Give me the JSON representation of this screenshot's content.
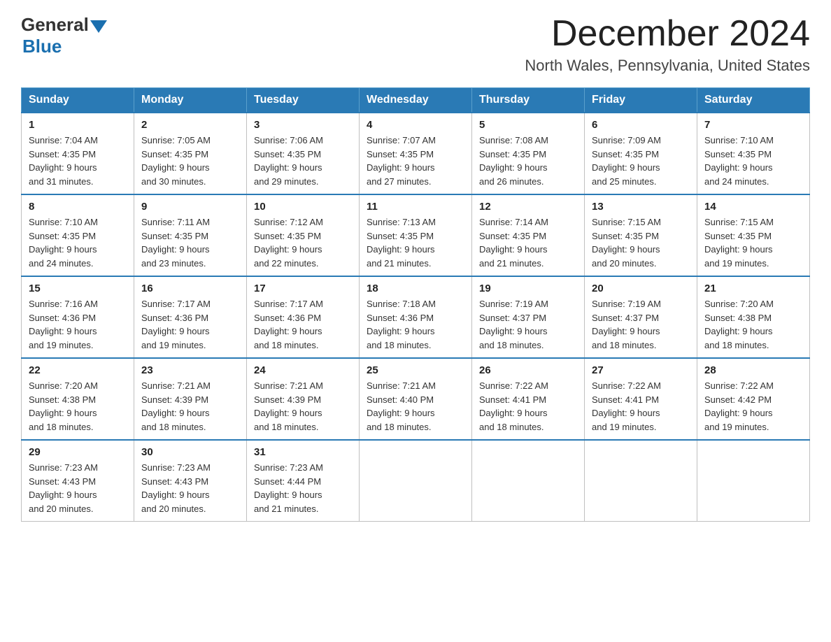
{
  "logo": {
    "general": "General",
    "blue": "Blue"
  },
  "title": {
    "month_year": "December 2024",
    "location": "North Wales, Pennsylvania, United States"
  },
  "weekdays": [
    "Sunday",
    "Monday",
    "Tuesday",
    "Wednesday",
    "Thursday",
    "Friday",
    "Saturday"
  ],
  "weeks": [
    [
      {
        "day": "1",
        "sunrise": "7:04 AM",
        "sunset": "4:35 PM",
        "daylight": "9 hours and 31 minutes."
      },
      {
        "day": "2",
        "sunrise": "7:05 AM",
        "sunset": "4:35 PM",
        "daylight": "9 hours and 30 minutes."
      },
      {
        "day": "3",
        "sunrise": "7:06 AM",
        "sunset": "4:35 PM",
        "daylight": "9 hours and 29 minutes."
      },
      {
        "day": "4",
        "sunrise": "7:07 AM",
        "sunset": "4:35 PM",
        "daylight": "9 hours and 27 minutes."
      },
      {
        "day": "5",
        "sunrise": "7:08 AM",
        "sunset": "4:35 PM",
        "daylight": "9 hours and 26 minutes."
      },
      {
        "day": "6",
        "sunrise": "7:09 AM",
        "sunset": "4:35 PM",
        "daylight": "9 hours and 25 minutes."
      },
      {
        "day": "7",
        "sunrise": "7:10 AM",
        "sunset": "4:35 PM",
        "daylight": "9 hours and 24 minutes."
      }
    ],
    [
      {
        "day": "8",
        "sunrise": "7:10 AM",
        "sunset": "4:35 PM",
        "daylight": "9 hours and 24 minutes."
      },
      {
        "day": "9",
        "sunrise": "7:11 AM",
        "sunset": "4:35 PM",
        "daylight": "9 hours and 23 minutes."
      },
      {
        "day": "10",
        "sunrise": "7:12 AM",
        "sunset": "4:35 PM",
        "daylight": "9 hours and 22 minutes."
      },
      {
        "day": "11",
        "sunrise": "7:13 AM",
        "sunset": "4:35 PM",
        "daylight": "9 hours and 21 minutes."
      },
      {
        "day": "12",
        "sunrise": "7:14 AM",
        "sunset": "4:35 PM",
        "daylight": "9 hours and 21 minutes."
      },
      {
        "day": "13",
        "sunrise": "7:15 AM",
        "sunset": "4:35 PM",
        "daylight": "9 hours and 20 minutes."
      },
      {
        "day": "14",
        "sunrise": "7:15 AM",
        "sunset": "4:35 PM",
        "daylight": "9 hours and 19 minutes."
      }
    ],
    [
      {
        "day": "15",
        "sunrise": "7:16 AM",
        "sunset": "4:36 PM",
        "daylight": "9 hours and 19 minutes."
      },
      {
        "day": "16",
        "sunrise": "7:17 AM",
        "sunset": "4:36 PM",
        "daylight": "9 hours and 19 minutes."
      },
      {
        "day": "17",
        "sunrise": "7:17 AM",
        "sunset": "4:36 PM",
        "daylight": "9 hours and 18 minutes."
      },
      {
        "day": "18",
        "sunrise": "7:18 AM",
        "sunset": "4:36 PM",
        "daylight": "9 hours and 18 minutes."
      },
      {
        "day": "19",
        "sunrise": "7:19 AM",
        "sunset": "4:37 PM",
        "daylight": "9 hours and 18 minutes."
      },
      {
        "day": "20",
        "sunrise": "7:19 AM",
        "sunset": "4:37 PM",
        "daylight": "9 hours and 18 minutes."
      },
      {
        "day": "21",
        "sunrise": "7:20 AM",
        "sunset": "4:38 PM",
        "daylight": "9 hours and 18 minutes."
      }
    ],
    [
      {
        "day": "22",
        "sunrise": "7:20 AM",
        "sunset": "4:38 PM",
        "daylight": "9 hours and 18 minutes."
      },
      {
        "day": "23",
        "sunrise": "7:21 AM",
        "sunset": "4:39 PM",
        "daylight": "9 hours and 18 minutes."
      },
      {
        "day": "24",
        "sunrise": "7:21 AM",
        "sunset": "4:39 PM",
        "daylight": "9 hours and 18 minutes."
      },
      {
        "day": "25",
        "sunrise": "7:21 AM",
        "sunset": "4:40 PM",
        "daylight": "9 hours and 18 minutes."
      },
      {
        "day": "26",
        "sunrise": "7:22 AM",
        "sunset": "4:41 PM",
        "daylight": "9 hours and 18 minutes."
      },
      {
        "day": "27",
        "sunrise": "7:22 AM",
        "sunset": "4:41 PM",
        "daylight": "9 hours and 19 minutes."
      },
      {
        "day": "28",
        "sunrise": "7:22 AM",
        "sunset": "4:42 PM",
        "daylight": "9 hours and 19 minutes."
      }
    ],
    [
      {
        "day": "29",
        "sunrise": "7:23 AM",
        "sunset": "4:43 PM",
        "daylight": "9 hours and 20 minutes."
      },
      {
        "day": "30",
        "sunrise": "7:23 AM",
        "sunset": "4:43 PM",
        "daylight": "9 hours and 20 minutes."
      },
      {
        "day": "31",
        "sunrise": "7:23 AM",
        "sunset": "4:44 PM",
        "daylight": "9 hours and 21 minutes."
      },
      null,
      null,
      null,
      null
    ]
  ],
  "labels": {
    "sunrise": "Sunrise:",
    "sunset": "Sunset:",
    "daylight": "Daylight:"
  }
}
